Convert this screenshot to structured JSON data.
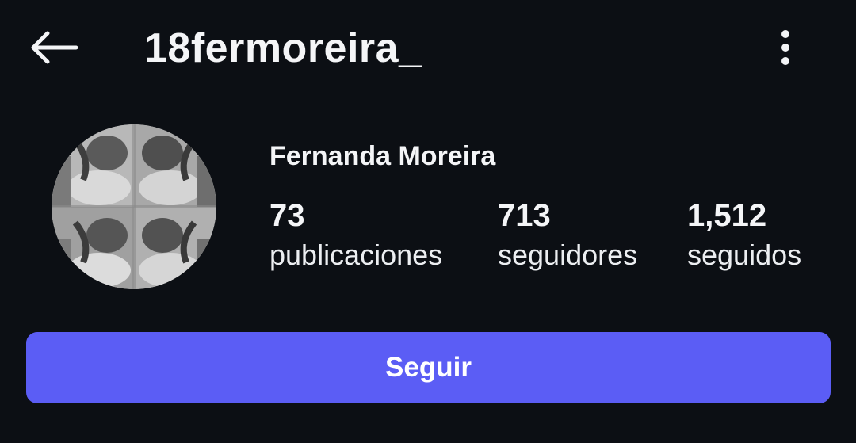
{
  "header": {
    "username": "18fermoreira_",
    "back_icon": "arrow-left-icon",
    "menu_icon": "more-vertical-icon"
  },
  "profile": {
    "display_name": "Fernanda Moreira",
    "avatar_icon": "profile-avatar",
    "stats": [
      {
        "value": "73",
        "label": "publicaciones"
      },
      {
        "value": "713",
        "label": "seguidores"
      },
      {
        "value": "1,512",
        "label": "seguidos"
      }
    ]
  },
  "actions": {
    "follow_label": "Seguir"
  },
  "colors": {
    "background": "#0c0f14",
    "accent": "#5b5df5",
    "text": "#f4f5f7"
  }
}
